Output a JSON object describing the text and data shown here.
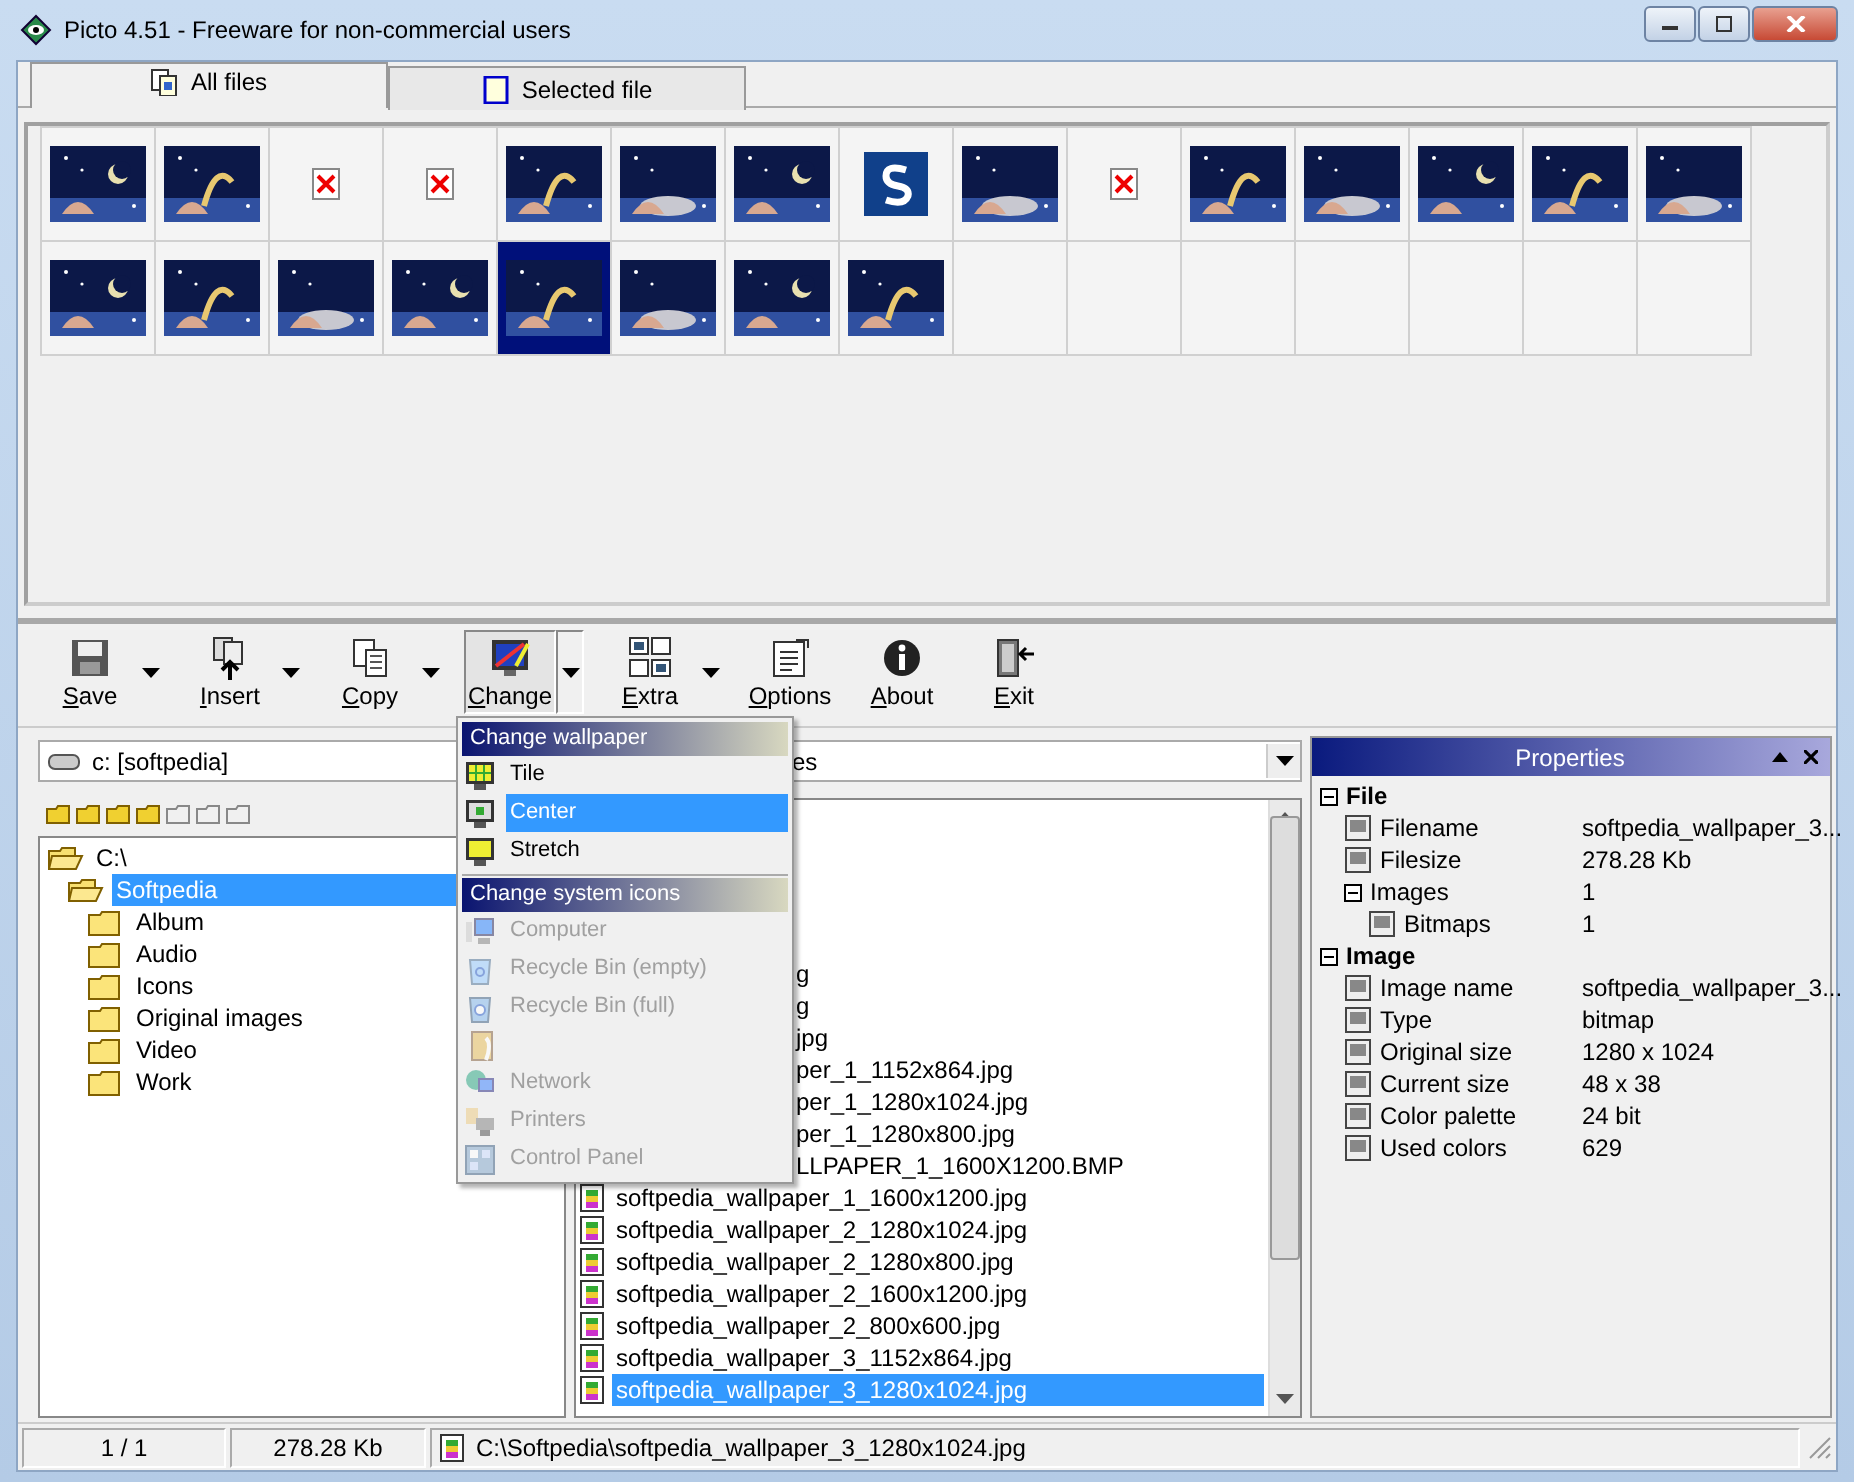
{
  "window": {
    "title": "Picto 4.51 - Freeware for non-commercial users"
  },
  "tabs": [
    {
      "label": "All files",
      "selected": true
    },
    {
      "label": "Selected file",
      "selected": false
    }
  ],
  "thumbnails": [
    [
      {
        "kind": "picture",
        "selected": false
      },
      {
        "kind": "picture",
        "selected": false
      },
      {
        "kind": "broken",
        "selected": false
      },
      {
        "kind": "broken",
        "selected": false
      },
      {
        "kind": "picture",
        "selected": false
      },
      {
        "kind": "picture",
        "selected": false
      },
      {
        "kind": "picture",
        "selected": false
      },
      {
        "kind": "logo",
        "selected": false
      },
      {
        "kind": "picture",
        "selected": false
      },
      {
        "kind": "broken",
        "selected": false
      },
      {
        "kind": "picture",
        "selected": false
      },
      {
        "kind": "picture",
        "selected": false
      },
      {
        "kind": "picture",
        "selected": false
      },
      {
        "kind": "picture",
        "selected": false
      },
      {
        "kind": "picture",
        "selected": false
      }
    ],
    [
      {
        "kind": "picture",
        "selected": false
      },
      {
        "kind": "picture",
        "selected": false
      },
      {
        "kind": "picture",
        "selected": false
      },
      {
        "kind": "picture",
        "selected": false
      },
      {
        "kind": "picture",
        "selected": true
      },
      {
        "kind": "picture",
        "selected": false
      },
      {
        "kind": "picture",
        "selected": false
      },
      {
        "kind": "picture",
        "selected": false
      },
      {
        "kind": "empty",
        "selected": false
      },
      {
        "kind": "empty",
        "selected": false
      },
      {
        "kind": "empty",
        "selected": false
      },
      {
        "kind": "empty",
        "selected": false
      },
      {
        "kind": "empty",
        "selected": false
      },
      {
        "kind": "empty",
        "selected": false
      },
      {
        "kind": "empty",
        "selected": false
      }
    ]
  ],
  "toolbar": [
    {
      "label": "Save",
      "dropdown": true,
      "pressed": false
    },
    {
      "label": "Insert",
      "dropdown": true,
      "pressed": false
    },
    {
      "label": "Copy",
      "dropdown": true,
      "pressed": false
    },
    {
      "label": "Change",
      "dropdown": true,
      "pressed": true
    },
    {
      "label": "Extra",
      "dropdown": true,
      "pressed": false
    },
    {
      "label": "Options",
      "dropdown": false,
      "pressed": false
    },
    {
      "label": "About",
      "dropdown": false,
      "pressed": false
    },
    {
      "label": "Exit",
      "dropdown": false,
      "pressed": false
    }
  ],
  "drive_select": {
    "value": "c: [softpedia]"
  },
  "path_buttons": [
    {
      "filled": true
    },
    {
      "filled": true
    },
    {
      "filled": true
    },
    {
      "filled": true
    },
    {
      "filled": false
    },
    {
      "filled": false
    },
    {
      "filled": false
    }
  ],
  "folder_tree": [
    {
      "label": "C:\\",
      "expanded": true,
      "selected": false,
      "children": [
        {
          "label": "Softpedia",
          "expanded": true,
          "selected": true,
          "children": [
            {
              "label": "Album",
              "expanded": false,
              "selected": false
            },
            {
              "label": "Audio",
              "expanded": false,
              "selected": false
            },
            {
              "label": "Icons",
              "expanded": false,
              "selected": false
            },
            {
              "label": "Original images",
              "expanded": false,
              "selected": false
            },
            {
              "label": "Video",
              "expanded": false,
              "selected": false
            },
            {
              "label": "Work",
              "expanded": false,
              "selected": false
            }
          ]
        }
      ]
    }
  ],
  "filter_select": {
    "value": "es"
  },
  "file_list": [
    {
      "name": "g",
      "kind": "covered",
      "selected": false
    },
    {
      "name": "g",
      "kind": "covered",
      "selected": false
    },
    {
      "name": "jpg",
      "kind": "covered",
      "selected": false
    },
    {
      "name": "per_1_1152x864.jpg",
      "kind": "covered",
      "selected": false
    },
    {
      "name": "per_1_1280x1024.jpg",
      "kind": "covered",
      "selected": false
    },
    {
      "name": "per_1_1280x800.jpg",
      "kind": "covered",
      "selected": false
    },
    {
      "name": "LLPAPER_1_1600X1200.BMP",
      "kind": "covered",
      "selected": false
    },
    {
      "name": "softpedia_wallpaper_1_1600x1200.jpg",
      "kind": "full",
      "selected": false
    },
    {
      "name": "softpedia_wallpaper_2_1280x1024.jpg",
      "kind": "full",
      "selected": false
    },
    {
      "name": "softpedia_wallpaper_2_1280x800.jpg",
      "kind": "full",
      "selected": false
    },
    {
      "name": "softpedia_wallpaper_2_1600x1200.jpg",
      "kind": "full",
      "selected": false
    },
    {
      "name": "softpedia_wallpaper_2_800x600.jpg",
      "kind": "full",
      "selected": false
    },
    {
      "name": "softpedia_wallpaper_3_1152x864.jpg",
      "kind": "full",
      "selected": false
    },
    {
      "name": "softpedia_wallpaper_3_1280x1024.jpg",
      "kind": "full",
      "selected": true
    }
  ],
  "context_menu": [
    {
      "kind": "header",
      "label": "Change wallpaper"
    },
    {
      "kind": "item",
      "label": "Tile",
      "selected": false,
      "disabled": false
    },
    {
      "kind": "item",
      "label": "Center",
      "selected": true,
      "disabled": false
    },
    {
      "kind": "item",
      "label": "Stretch",
      "selected": false,
      "disabled": false
    },
    {
      "kind": "separator"
    },
    {
      "kind": "header",
      "label": "Change system icons"
    },
    {
      "kind": "item",
      "label": "Computer",
      "selected": false,
      "disabled": true
    },
    {
      "kind": "item",
      "label": "Recycle Bin (empty)",
      "selected": false,
      "disabled": true
    },
    {
      "kind": "item",
      "label": "Recycle Bin (full)",
      "selected": false,
      "disabled": true
    },
    {
      "kind": "item",
      "selected": false,
      "disabled": true
    },
    {
      "kind": "item",
      "label": "Network",
      "selected": false,
      "disabled": true
    },
    {
      "kind": "item",
      "label": "Printers",
      "selected": false,
      "disabled": true
    },
    {
      "kind": "item",
      "label": "Control Panel",
      "selected": false,
      "disabled": true
    }
  ],
  "properties": {
    "title": "Properties",
    "groups": [
      {
        "label": "File",
        "expanded": true,
        "children": [
          {
            "label": "Filename",
            "value": "softpedia_wallpaper_3..."
          },
          {
            "label": "Filesize",
            "value": "278.28 Kb"
          },
          {
            "label": "Images",
            "value": "1",
            "expanded": true,
            "children": [
              {
                "label": "Bitmaps",
                "value": "1"
              }
            ]
          }
        ]
      },
      {
        "label": "Image",
        "expanded": true,
        "children": [
          {
            "label": "Image name",
            "value": "softpedia_wallpaper_3..."
          },
          {
            "label": "Type",
            "value": "bitmap"
          },
          {
            "label": "Original size",
            "value": "1280 x 1024"
          },
          {
            "label": "Current size",
            "value": "48 x 38"
          },
          {
            "label": "Color palette",
            "value": "24 bit"
          },
          {
            "label": "Used colors",
            "value": "629"
          }
        ]
      }
    ]
  },
  "status_bar": {
    "count": "1 / 1",
    "size": "278.28 Kb",
    "path": "C:\\Softpedia\\softpedia_wallpaper_3_1280x1024.jpg"
  }
}
